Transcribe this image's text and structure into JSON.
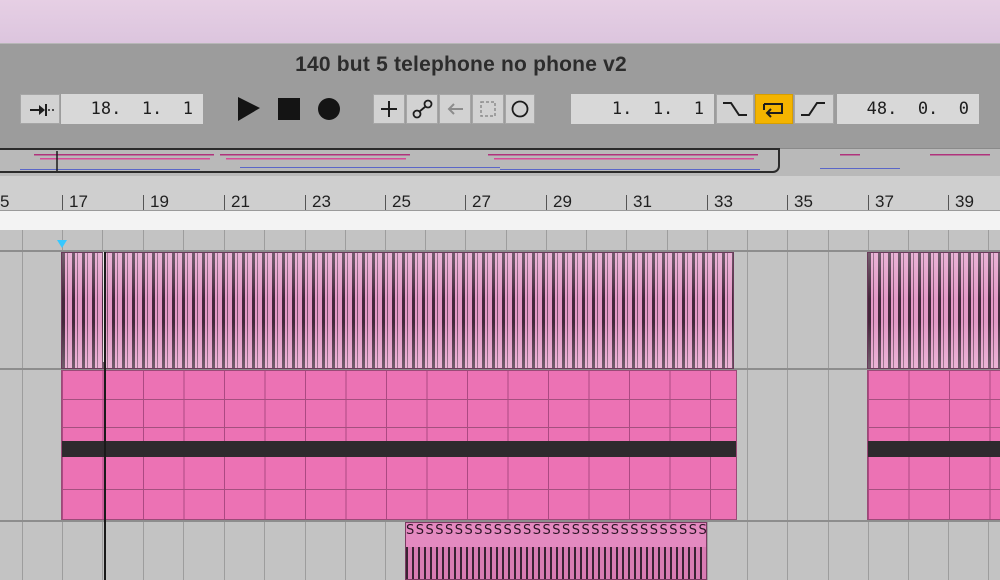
{
  "window": {
    "title": "140 but 5 telephone no phone v2"
  },
  "transport": {
    "arrangement_position": "18.  1.  1",
    "loop_start": "1.  1.  1",
    "loop_length": "48.  0.  0"
  },
  "ruler": {
    "bars": [
      "5",
      "17",
      "19",
      "21",
      "23",
      "25",
      "27",
      "29",
      "31",
      "33",
      "35",
      "37",
      "39"
    ]
  },
  "colors": {
    "clip": "#ec72b4",
    "loop_active": "#f4b400",
    "cue": "#37c8ff"
  },
  "icons": [
    "follow-icon",
    "play-icon",
    "stop-icon",
    "record-icon",
    "add-icon",
    "automation-icon",
    "back-icon",
    "capture-icon",
    "loop-record-icon",
    "punch-in-icon",
    "loop-icon",
    "punch-out-icon"
  ],
  "clips": {
    "small_clip_label": "SSSSSSSSSSSSSSSSSSSSSSSSSSSSSSSSSSSS"
  }
}
